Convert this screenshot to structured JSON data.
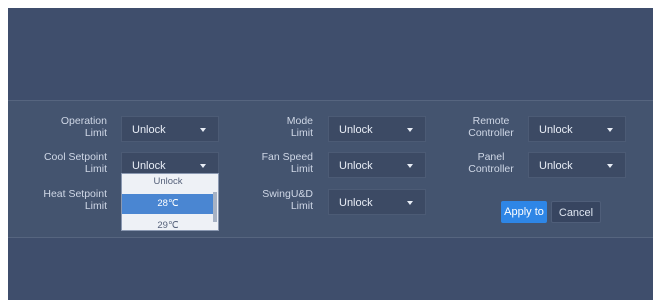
{
  "settings": {
    "operation_limit": {
      "label": "Operation\nLimit",
      "value": "Unlock"
    },
    "cool_setpoint_limit": {
      "label": "Cool Setpoint\nLimit",
      "value": "Unlock"
    },
    "heat_setpoint_limit": {
      "label": "Heat Setpoint\nLimit"
    },
    "mode_limit": {
      "label": "Mode\nLimit",
      "value": "Unlock"
    },
    "fan_speed_limit": {
      "label": "Fan Speed\nLimit",
      "value": "Unlock"
    },
    "swing_limit": {
      "label": "SwingU&D\nLimit",
      "value": "Unlock"
    },
    "remote_controller": {
      "label": "Remote\nController",
      "value": "Unlock"
    },
    "panel_controller": {
      "label": "Panel\nController",
      "value": "Unlock"
    }
  },
  "dropdown": {
    "options": [
      "Unlock",
      "28℃",
      "29℃"
    ],
    "selected": "28℃"
  },
  "buttons": {
    "apply": "Apply to",
    "cancel": "Cancel"
  },
  "colors": {
    "background": "#3f4e6c",
    "panel": "#44546f",
    "accent": "#2e86e6",
    "selected_option": "#4a86d2"
  },
  "icons": {
    "select_caret": "caret-down-icon"
  }
}
